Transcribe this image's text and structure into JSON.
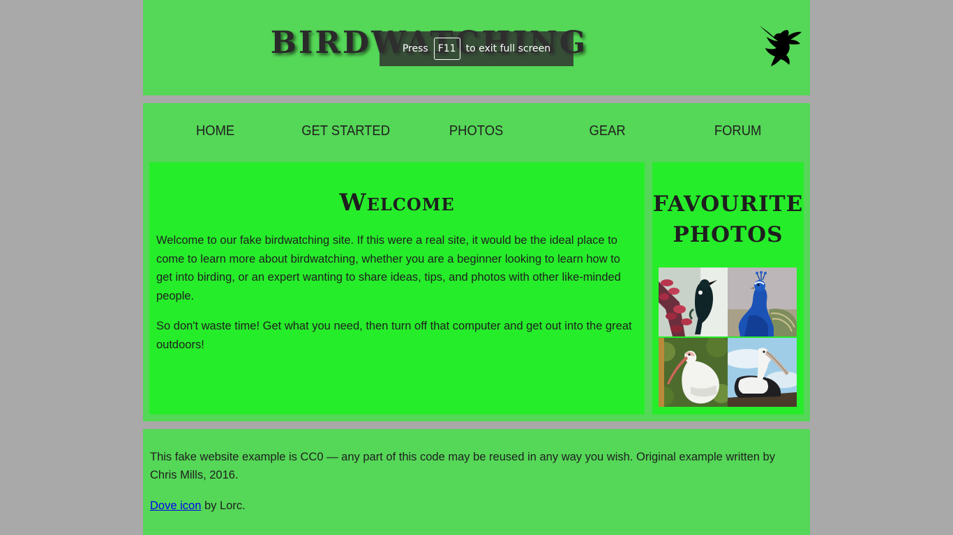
{
  "header": {
    "site_title": "BIRDWATCHING",
    "logo_icon": "dove-icon"
  },
  "fullscreen_notice": {
    "prefix": "Press",
    "key": "F11",
    "suffix": "to exit full screen"
  },
  "nav": {
    "items": [
      {
        "label": "HOME"
      },
      {
        "label": "GET STARTED"
      },
      {
        "label": "PHOTOS"
      },
      {
        "label": "GEAR"
      },
      {
        "label": "FORUM"
      }
    ]
  },
  "article": {
    "heading": "Welcome",
    "paragraphs": [
      "Welcome to our fake birdwatching site. If this were a real site, it would be the ideal place to come to learn more about birdwatching, whether you are a beginner looking to learn how to get into birding, or an expert wanting to share ideas, tips, and photos with other like-minded people.",
      "So don't waste time! Get what you need, then turn off that computer and get out into the great outdoors!"
    ]
  },
  "aside": {
    "heading": "FAVOURITE PHOTOS",
    "photos": [
      "tui-photo",
      "peacock-photo",
      "ibis-photo",
      "stork-photo"
    ]
  },
  "footer": {
    "license_text": "This fake website example is CC0 — any part of this code may be reused in any way you wish. Original example written by Chris Mills, 2016.",
    "credit_link": "Dove icon",
    "credit_suffix": " by Lorc."
  },
  "colors": {
    "page_background": "#a9a9a9",
    "panel_green": "#55d757",
    "content_green": "#26ed2a",
    "link_blue": "#0000ee"
  }
}
